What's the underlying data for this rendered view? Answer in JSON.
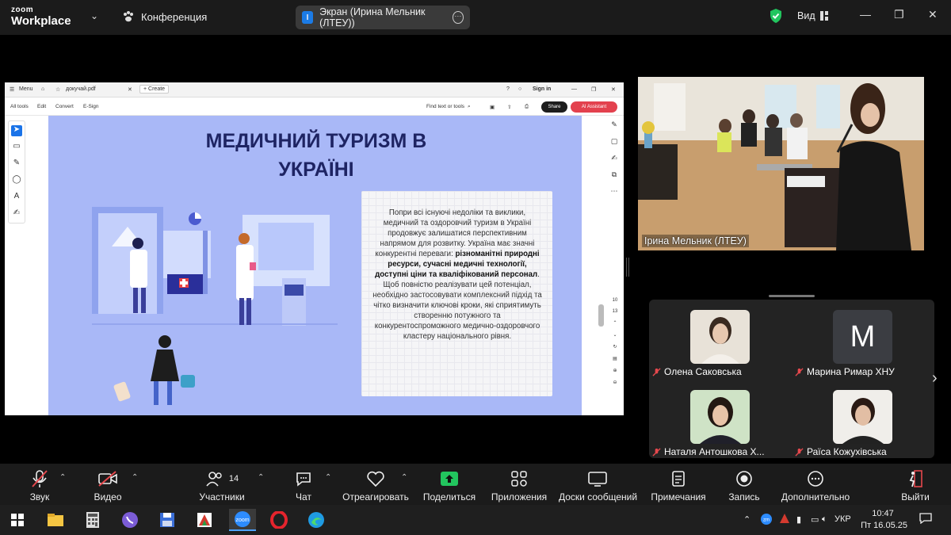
{
  "app": {
    "logo_top": "zoom",
    "logo_bottom": "Workplace",
    "conference_label": "Конференция",
    "screen_share_label": "Экран (Ирина Мельник  (ЛТЕУ))",
    "screen_share_initial": "I",
    "view_label": "Вид"
  },
  "pdf": {
    "menu_label": "Menu",
    "file_tab": "докучай.pdf",
    "create_label": "Create",
    "sign_in": "Sign in",
    "tools": [
      "All tools",
      "Edit",
      "Convert",
      "E-Sign"
    ],
    "find_placeholder": "Find text or tools",
    "share_label": "Share",
    "ai_label": "AI Assistant",
    "page_current": "10",
    "page_total": "13"
  },
  "slide": {
    "title_line1": "МЕДИЧНИЙ ТУРИЗМ В",
    "title_line2": "УКРАЇНІ",
    "text_part1": "Попри всі існуючі недоліки та виклики, медичний та оздоровчий туризм в Україні продовжує залишатися перспективним напрямом для розвитку. Україна має значні конкурентні переваги: ",
    "text_bold": "різноманітні природні ресурси, сучасні медичні технології, доступні ціни та кваліфікований персонал",
    "text_part2": ". Щоб повністю реалізувати цей потенціал, необхідно застосовувати комплексний підхід та чітко визначити ключові кроки, які сприятимуть створенню потужного та конкурентоспроможного медично-оздоровчого кластеру національного рівня."
  },
  "speaker": {
    "name": "Ірина Мельник  (ЛТЕУ)"
  },
  "gallery": [
    {
      "name": "Олена Саковська",
      "avatar": "photo"
    },
    {
      "name": "Марина Римар ХНУ",
      "avatar": "M"
    },
    {
      "name": "Наталя Антошкова Х...",
      "avatar": "photo"
    },
    {
      "name": "Раїса Кожухівська",
      "avatar": "photo"
    }
  ],
  "toolbar": {
    "mute": "Звук",
    "video": "Видео",
    "participants": "Участники",
    "participants_count": "14",
    "chat": "Чат",
    "react": "Отреагировать",
    "share": "Поделиться",
    "apps": "Приложения",
    "whiteboards": "Доски сообщений",
    "notes": "Примечания",
    "record": "Запись",
    "more": "Дополнительно",
    "leave": "Выйти"
  },
  "taskbar": {
    "lang": "УКР",
    "time": "10:47",
    "date": "Пт 16.05.25"
  },
  "colors": {
    "slide_bg": "#a9b8f7",
    "title": "#1e2463",
    "accent_green": "#22c55e",
    "leave_red": "#e5484d",
    "ai_red": "#e3414e"
  }
}
